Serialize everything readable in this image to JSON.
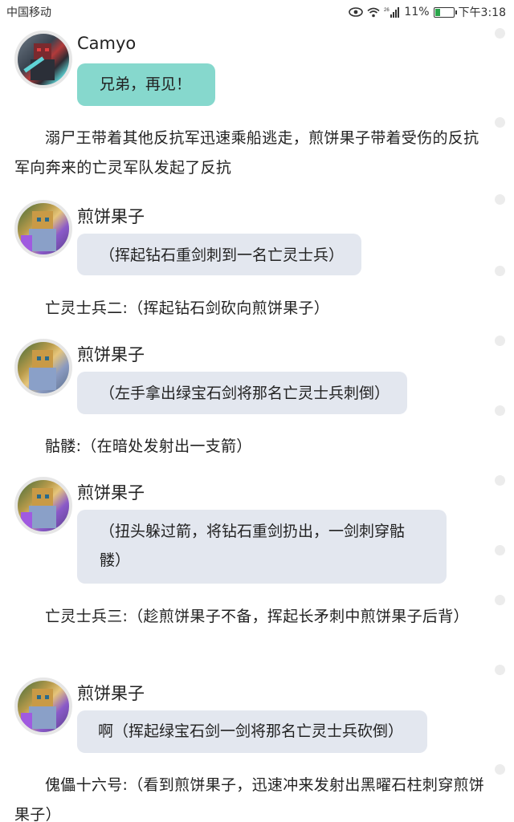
{
  "status_bar": {
    "carrier": "中国移动",
    "signal_label": "26",
    "battery_percent": "11%",
    "battery_level": 0.3,
    "time": "下午3:18"
  },
  "messages": [
    {
      "name": "Camyo",
      "text": "兄弟，再见！"
    },
    {
      "narration": "溺尸王带着其他反抗军迅速乘船逃走，煎饼果子带着受伤的反抗军向奔来的亡灵军队发起了反抗"
    },
    {
      "name": "煎饼果子",
      "text": "（挥起钻石重剑刺到一名亡灵士兵）"
    },
    {
      "narration": "亡灵士兵二:（挥起钻石剑砍向煎饼果子）"
    },
    {
      "name": "煎饼果子",
      "text": "（左手拿出绿宝石剑将那名亡灵士兵刺倒）"
    },
    {
      "narration": "骷髅:（在暗处发射出一支箭）"
    },
    {
      "name": "煎饼果子",
      "text_line1": "（扭头躲过箭，将钻石重剑扔出，一剑刺穿骷",
      "text_line2": "髅）"
    },
    {
      "narration": "亡灵士兵三:（趁煎饼果子不备，挥起长矛刺中煎饼果子后背）"
    },
    {
      "name": "煎饼果子",
      "text": "啊（挥起绿宝石剑一剑将那名亡灵士兵砍倒）"
    },
    {
      "narration": "傀儡十六号:（看到煎饼果子，迅速冲来发射出黑曜石柱刺穿煎饼果子）"
    }
  ],
  "colors": {
    "bubble_teal": "#86d8cd",
    "bubble_gray": "#e3e7ef"
  }
}
